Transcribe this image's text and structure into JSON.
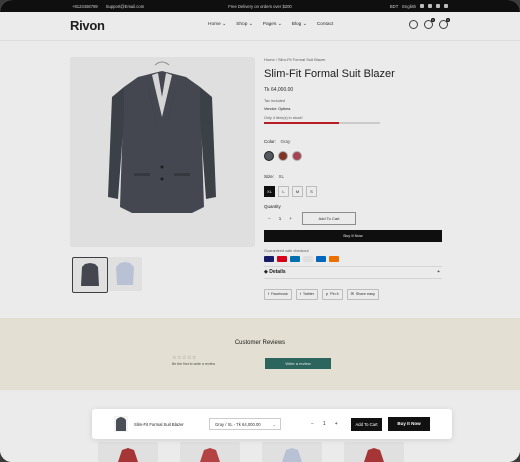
{
  "topbar": {
    "phone": "+8123456789",
    "email": "Support@Email.com",
    "promo": "Free Delivery on orders over $200",
    "currency": "BDT",
    "language": "English"
  },
  "header": {
    "logo": "Rivon",
    "nav": [
      {
        "label": "Home",
        "caret": "⌄"
      },
      {
        "label": "Shop",
        "caret": "⌄"
      },
      {
        "label": "Pages",
        "caret": "⌄"
      },
      {
        "label": "Blog",
        "caret": "⌄"
      },
      {
        "label": "Contact",
        "caret": ""
      }
    ],
    "wishlist_count": "0",
    "cart_count": "0"
  },
  "product": {
    "breadcrumb": "Home  /  Slim-Fit Formal Suit Blazer",
    "title": "Slim-Fit Formal Suit Blazer",
    "price": "Tk 64,000.00",
    "tax_note": "Tax included",
    "vendor_label": "Vendor:",
    "vendor": "Optima",
    "stock_text": "Only 4 item(s) in stock!",
    "stock_fraction": 0.65,
    "color_label": "Color:",
    "color_value": "Gray",
    "colors": [
      "#5c5f66",
      "#8a3a2a",
      "#b24a5a"
    ],
    "size_label": "Size:",
    "size_value": "XL",
    "sizes": [
      "XL",
      "L",
      "M",
      "S"
    ],
    "quantity_label": "Quantity",
    "quantity": "1",
    "add_to_cart": "Add To Cart",
    "buy_now": "Buy It Now",
    "checkout_label": "Guaranteed safe checkout",
    "payments": [
      "#1a1f71",
      "#eb001b",
      "#0079be",
      "#f2f2f2",
      "#006fcf",
      "#ff7a00"
    ],
    "details_label": "Details",
    "share": [
      {
        "label": "Facebook",
        "icon": "f"
      },
      {
        "label": "Twitter",
        "icon": "t"
      },
      {
        "label": "Pin it",
        "icon": "p"
      },
      {
        "label": "Share easy",
        "icon": "✉"
      }
    ]
  },
  "reviews": {
    "title": "Customer Reviews",
    "stars": "☆☆☆☆☆",
    "first_text": "Be the first to write a review",
    "write_button": "Write a review"
  },
  "sticky_bar": {
    "title": "Slim-Fit Formal Suit Blazer",
    "variant": "Gray / XL - Tk 64,000.00",
    "quantity": "1",
    "add_to_cart": "Add To Cart",
    "buy_now": "Buy It Now"
  }
}
